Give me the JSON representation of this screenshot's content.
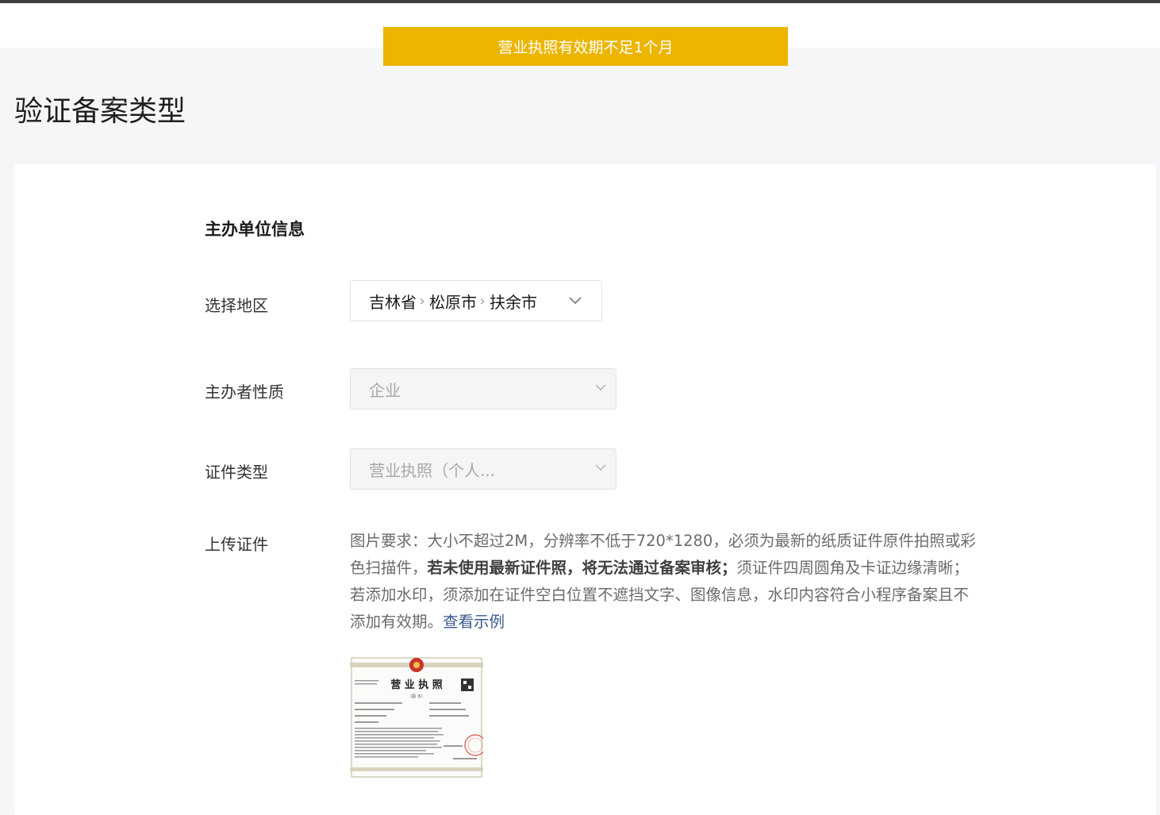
{
  "toast": {
    "text": "营业执照有效期不足1个月"
  },
  "page": {
    "title": "验证备案类型"
  },
  "section": {
    "title": "主办单位信息"
  },
  "region": {
    "label": "选择地区",
    "province": "吉林省",
    "city": "松原市",
    "county": "扶余市"
  },
  "sponsor_type": {
    "label": "主办者性质",
    "value": "企业"
  },
  "cert_type": {
    "label": "证件类型",
    "value": "营业执照（个人..."
  },
  "upload": {
    "label": "上传证件",
    "text_part1": "图片要求：大小不超过2M，分辨率不低于720*1280，必须为最新的纸质证件原件拍照或彩色扫描件，",
    "text_bold": "若未使用最新证件照，将无法通过备案审核；",
    "text_part2": "须证件四周圆角及卡证边缘清晰；若添加水印，须添加在证件空白位置不遮挡文字、图像信息，水印内容符合小程序备案且不添加有效期。",
    "example_link": "查看示例"
  },
  "license_image": {
    "heading": "营 业 执 照",
    "subheading": "(副 本)"
  },
  "colors": {
    "toast_bg": "#ecb500",
    "link": "#3c5a8c",
    "page_bg": "#f5f6f7"
  }
}
